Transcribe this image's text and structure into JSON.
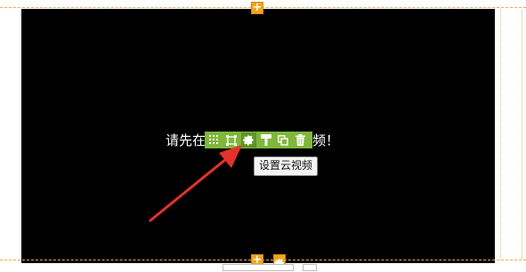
{
  "canvas": {
    "placeholder_message": "请先在此处设置云视频！",
    "message_visible_start": "请先在",
    "message_visible_end": "视频！"
  },
  "toolbar": {
    "items": [
      {
        "icon": "drag-grid-icon"
      },
      {
        "icon": "resize-frame-icon"
      },
      {
        "icon": "gear-icon",
        "active": true
      },
      {
        "icon": "format-brush-icon"
      },
      {
        "icon": "copy-icon"
      },
      {
        "icon": "trash-icon"
      }
    ],
    "tooltip": "设置云视频"
  },
  "controls": {
    "add_symbol": "+"
  },
  "colors": {
    "canvas_bg": "#000000",
    "toolbar_bg": "#7fb73a",
    "add_button": "#f3a51a",
    "guide_line": "#e8b04a",
    "arrow": "#e8302a"
  }
}
